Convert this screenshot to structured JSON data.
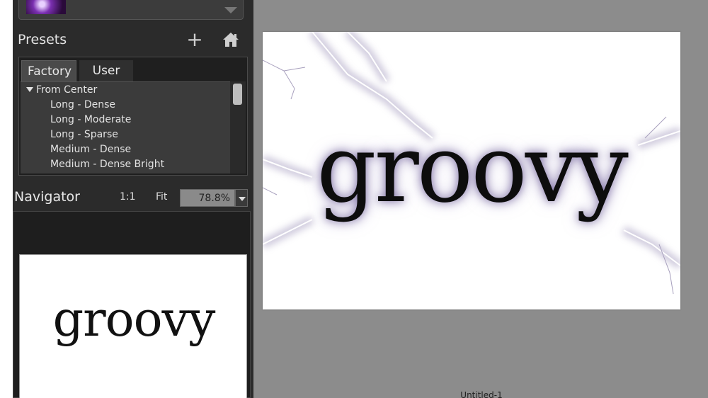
{
  "presets": {
    "title": "Presets",
    "add_icon": "plus-icon",
    "home_icon": "home-icon",
    "tabs": [
      "Factory",
      "User"
    ],
    "group": "From Center",
    "items": [
      "Long - Dense",
      "Long - Moderate",
      "Long - Sparse",
      "Medium - Dense",
      "Medium - Dense Bright"
    ]
  },
  "navigator": {
    "title": "Navigator",
    "zoom_actual": "1:1",
    "zoom_fit": "Fit",
    "zoom_value": "78.8%",
    "preview_text": "groovy"
  },
  "document": {
    "text": "groovy",
    "caption": "Untitled-1"
  },
  "colors": {
    "panel_bg": "#2b2b2b",
    "canvas_bg": "#8c8c8c",
    "glow": "#8a7fb5"
  }
}
